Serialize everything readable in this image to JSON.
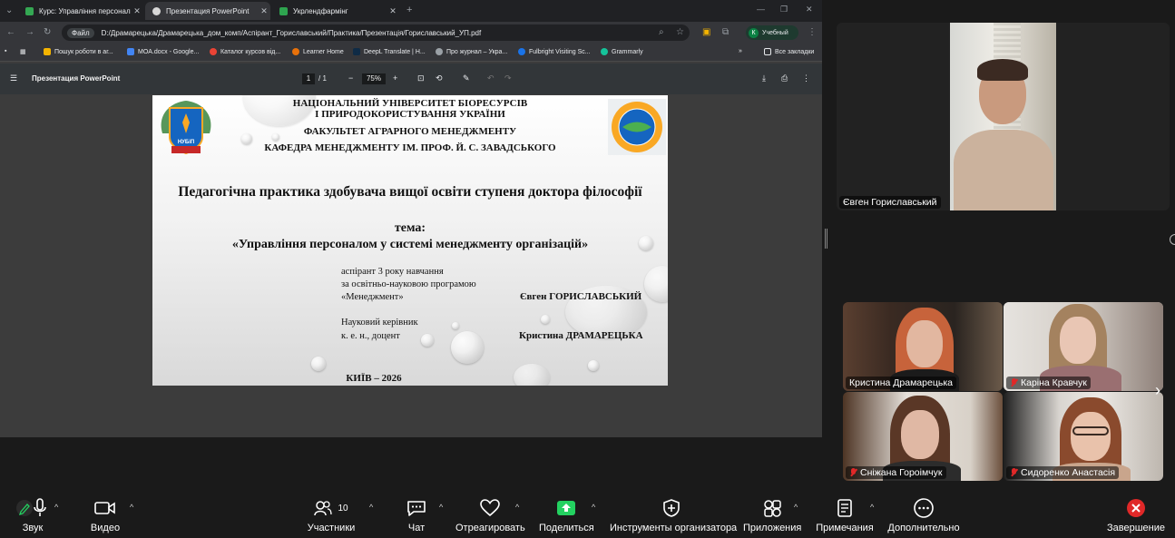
{
  "browser": {
    "tabs": [
      {
        "title": "Курс: Управління персоналом",
        "color": "#34a853"
      },
      {
        "title": "Презентация PowerPoint",
        "color": "#d8d8d8"
      },
      {
        "title": "Укрлендфармінг",
        "color": "#2ea44f"
      }
    ],
    "address": {
      "scheme_chip": "Файл",
      "url": "D:/Драмарецька/Драмарецька_дом_комп/Аспірант_Гориславський/Практика/Презентація/Гориславський_УП.pdf"
    },
    "profile": {
      "initial": "К",
      "label": "Учебный"
    },
    "bookmarks": [
      {
        "label": "Пошук роботи в аг...",
        "color": "#f4b400"
      },
      {
        "label": "MOA.docx - Google...",
        "color": "#4285f4"
      },
      {
        "label": "Каталог курсов від...",
        "color": "#ea4335"
      },
      {
        "label": "Learner Home",
        "color": "#e8710a"
      },
      {
        "label": "DeepL Translate | H...",
        "color": "#0f2b46"
      },
      {
        "label": "Про журнал – Укра...",
        "color": "#9aa0a6"
      },
      {
        "label": "Fulbright Visiting Sc...",
        "color": "#1a73e8"
      },
      {
        "label": "Grammarly",
        "color": "#15c39a"
      }
    ],
    "all_bookmarks": "Все закладки"
  },
  "pdf": {
    "title": "Презентация PowerPoint",
    "page": "1",
    "page_total": "/ 1",
    "zoom": "75%"
  },
  "slide": {
    "uni1": "НАЦІОНАЛЬНИЙ УНІВЕРСИТЕТ БІОРЕСУРСІВ",
    "uni2": "І ПРИРОДОКОРИСТУВАННЯ УКРАЇНИ",
    "faculty": "ФАКУЛЬТЕТ АГРАРНОГО МЕНЕДЖМЕНТУ",
    "dept": "КАФЕДРА МЕНЕДЖМЕНТУ ІМ. ПРОФ. Й. С. ЗАВАДСЬКОГО",
    "heading": "Педагогічна практика здобувача вищої освіти ступеня доктора філософії",
    "topic_label": "тема:",
    "topic": "«Управління персоналом у системі менеджменту організацій»",
    "asp1": "аспірант 3 року навчання",
    "asp2": "за освітньо-науковою програмою",
    "asp3": "«Менеджмент»",
    "asp_name": "Євген ГОРИСЛАВСЬКИЙ",
    "sup1": "Науковий керівник",
    "sup2": "к. е. н., доцент",
    "sup_name": "Кристина ДРАМАРЕЦЬКА",
    "footer": "КИЇВ – 2026",
    "logo_text": "НУБіП"
  },
  "participants": {
    "speaker": {
      "name": "Євген Гориславський"
    },
    "tiles": [
      {
        "name": "Кристина Драмарецька",
        "muted": false
      },
      {
        "name": "Каріна Кравчук",
        "muted": true
      },
      {
        "name": "Сніжана Гороімчук",
        "muted": true
      },
      {
        "name": "Сидоренко Анастасія",
        "muted": true
      }
    ]
  },
  "toolbar": {
    "audio": "Звук",
    "video": "Видео",
    "participants": "Участники",
    "participants_count": "10",
    "chat": "Чат",
    "react": "Отреагировать",
    "share": "Поделиться",
    "host_tools": "Инструменты организатора",
    "apps": "Приложения",
    "notes": "Примечания",
    "more": "Дополнительно",
    "end": "Завершение",
    "share_color": "#23d160",
    "end_color": "#e02828"
  }
}
